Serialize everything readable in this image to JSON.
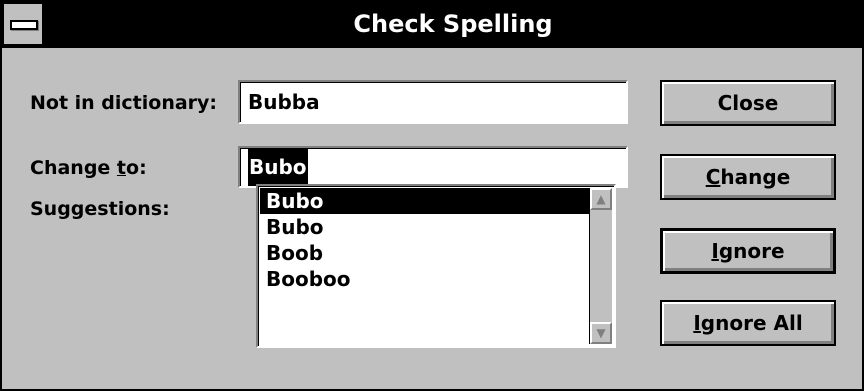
{
  "window": {
    "title": "Check Spelling"
  },
  "labels": {
    "not_in_dictionary": "Not in dictionary:",
    "change_to_pre": "Change ",
    "change_to_accel": "t",
    "change_to_post": "o:",
    "suggestions": "Suggestions:"
  },
  "fields": {
    "not_in_dictionary_value": "Bubba",
    "change_to_value": "Bubo"
  },
  "suggestions": {
    "items": [
      "Bubo",
      "Bubo",
      "Boob",
      "Booboo"
    ],
    "selected_index": 0
  },
  "buttons": {
    "close": {
      "label": "Close"
    },
    "change": {
      "accel": "C",
      "rest": "hange"
    },
    "ignore": {
      "accel": "I",
      "rest": "gnore"
    },
    "ignore_all": {
      "accel": "I",
      "mid": "g",
      "rest": "nore All"
    }
  },
  "icons": {
    "system_menu": "system-menu-icon",
    "scroll_up": "scroll-up-arrow-icon",
    "scroll_down": "scroll-down-arrow-icon"
  }
}
